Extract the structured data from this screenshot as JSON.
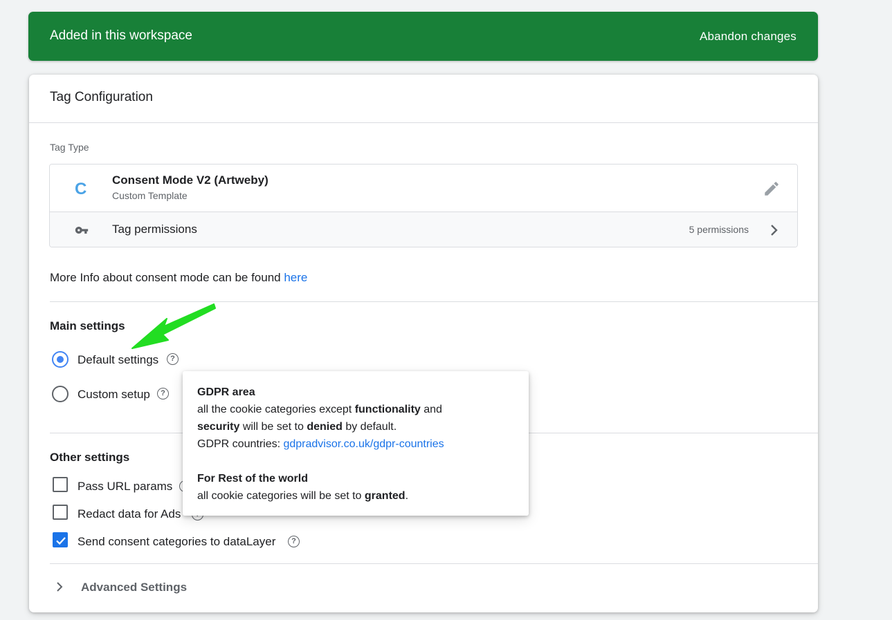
{
  "banner": {
    "title": "Added in this workspace",
    "abandon_label": "Abandon changes",
    "color": "#188038"
  },
  "card": {
    "title": "Tag Configuration",
    "tag_type_label": "Tag Type",
    "template": {
      "icon_letter": "C",
      "name": "Consent Mode V2 (Artweby)",
      "subtitle": "Custom Template",
      "icon": "edit-pencil-icon"
    },
    "permissions": {
      "label": "Tag permissions",
      "count": "5 permissions",
      "icon": "key-icon"
    }
  },
  "info": {
    "text": "More Info about consent mode can be found ",
    "link": "here"
  },
  "main_settings": {
    "heading": "Main settings",
    "options": [
      {
        "label": "Default settings",
        "checked": true
      },
      {
        "label": "Custom setup",
        "checked": false
      }
    ]
  },
  "other_settings": {
    "heading": "Other settings",
    "options": [
      {
        "label": "Pass URL params",
        "checked": false
      },
      {
        "label": "Redact data for Ads",
        "checked": false
      },
      {
        "label": "Send consent categories to dataLayer",
        "checked": true
      }
    ]
  },
  "advanced": {
    "label": "Advanced Settings"
  },
  "tooltip": {
    "gdpr_title": "GDPR area",
    "line1_a": "all the cookie categories except ",
    "line1_b": "functionality",
    "line1_c": " and",
    "line2_a": "security",
    "line2_b": " will be set to ",
    "line2_c": "denied",
    "line2_d": " by default.",
    "line3_a": "GDPR countries: ",
    "line3_link": "gdpradvisor.co.uk/gdpr-countries",
    "rest_title": "For Rest of the world",
    "line4_a": "all cookie categories will be set to ",
    "line4_b": "granted",
    "line4_c": "."
  },
  "accent_color": "#1a73e8",
  "annotation_arrow_color": "#22dd22"
}
